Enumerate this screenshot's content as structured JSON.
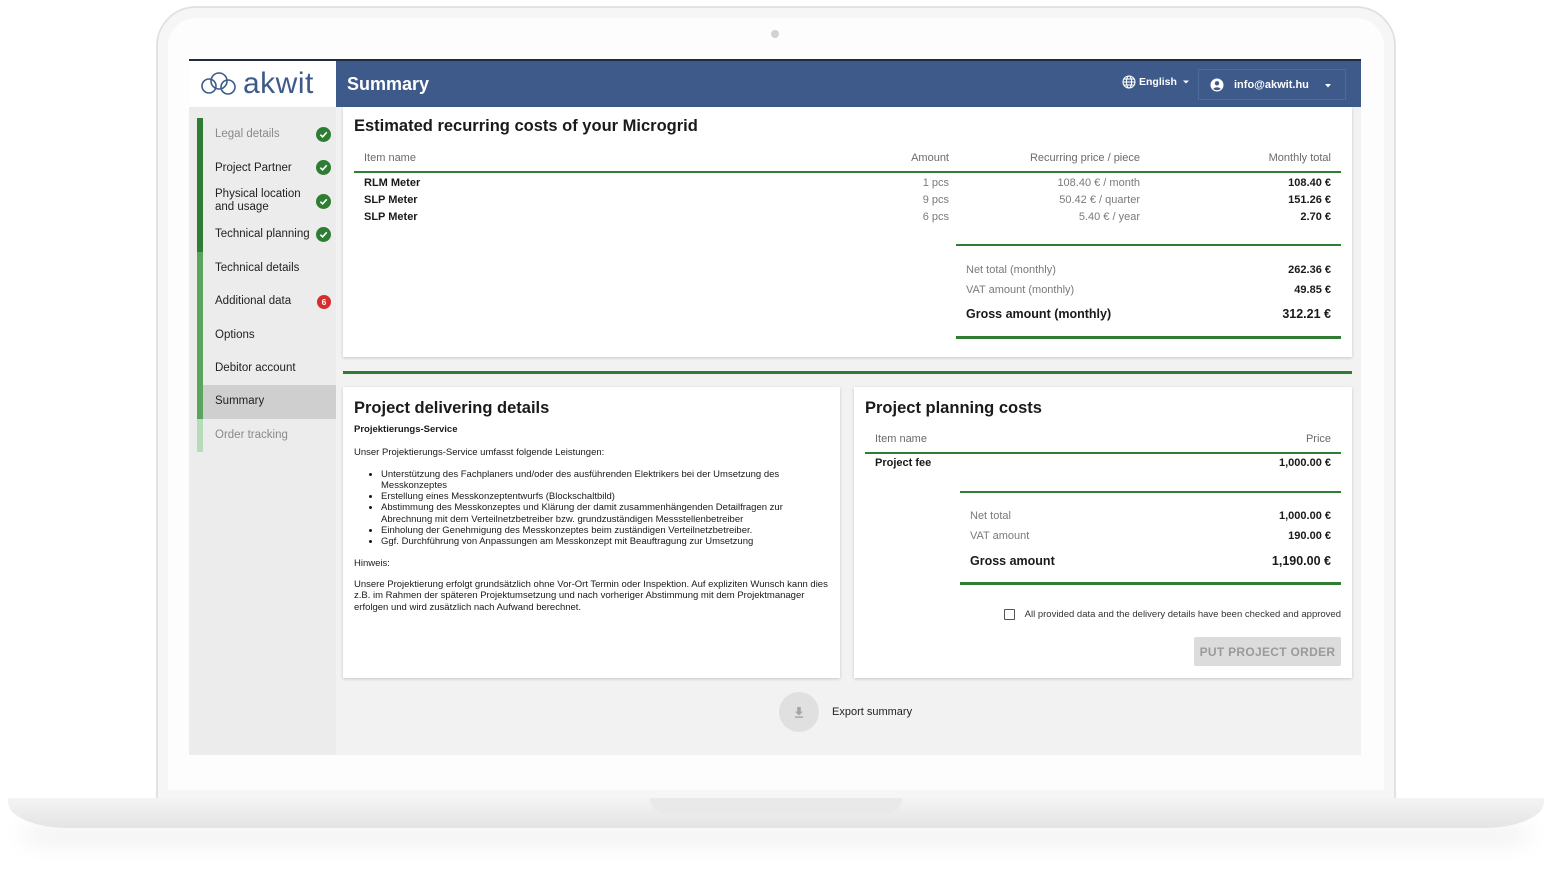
{
  "brand": {
    "name": "akwit",
    "color": "#3d5a8a"
  },
  "colors": {
    "header": "#3d5a8a",
    "accent_green": "#2e7d32",
    "error_red": "#d32f2f"
  },
  "header": {
    "title": "Summary",
    "language": "English",
    "user_email": "info@akwit.hu"
  },
  "sidebar": {
    "items": [
      {
        "label": "Legal details",
        "status": "done"
      },
      {
        "label": "Project Partner",
        "status": "done"
      },
      {
        "label": "Physical location and usage",
        "status": "done"
      },
      {
        "label": "Technical planning",
        "status": "done"
      },
      {
        "label": "Technical details",
        "status": "none"
      },
      {
        "label": "Additional data",
        "status": "error",
        "badge": "6"
      },
      {
        "label": "Options",
        "status": "none"
      },
      {
        "label": "Debitor account",
        "status": "none"
      },
      {
        "label": "Summary",
        "status": "active"
      },
      {
        "label": "Order tracking",
        "status": "disabled"
      }
    ]
  },
  "recurring": {
    "title": "Estimated recurring costs of your Microgrid",
    "columns": {
      "item": "Item name",
      "amount": "Amount",
      "price": "Recurring price / piece",
      "total": "Monthly total"
    },
    "rows": [
      {
        "item": "RLM Meter",
        "amount": "1 pcs",
        "price": "108.40 € / month",
        "total": "108.40 €"
      },
      {
        "item": "SLP Meter",
        "amount": "9 pcs",
        "price": "50.42 € / quarter",
        "total": "151.26 €"
      },
      {
        "item": "SLP Meter",
        "amount": "6 pcs",
        "price": "5.40 € / year",
        "total": "2.70 €"
      }
    ],
    "net_label": "Net total (monthly)",
    "net_value": "262.36 €",
    "vat_label": "VAT amount (monthly)",
    "vat_value": "49.85 €",
    "gross_label": "Gross amount (monthly)",
    "gross_value": "312.21 €"
  },
  "delivering": {
    "title": "Project delivering details",
    "service_name": "Projektierungs-Service",
    "intro": "Unser Projektierungs-Service umfasst folgende Leistungen:",
    "bullets": [
      "Unterstützung des Fachplaners und/oder des ausführenden Elektrikers bei der Umsetzung des Messkonzeptes",
      "Erstellung eines Messkonzeptentwurfs (Blockschaltbild)",
      "Abstimmung des Messkonzeptes und Klärung der damit zusammenhängenden Detailfragen zur Abrechnung mit dem Verteilnetzbetreiber bzw. grundzuständigen Messstellenbetreiber",
      "Einholung der Genehmigung des Messkonzeptes beim zuständigen Verteilnetzbetreiber.",
      "Ggf. Durchführung von Anpassungen am Messkonzept mit Beauftragung zur Umsetzung"
    ],
    "note_label": "Hinweis:",
    "note": "Unsere Projektierung erfolgt grundsätzlich ohne Vor-Ort Termin oder Inspektion. Auf expliziten Wunsch kann dies z.B. im Rahmen der späteren Projektumsetzung und nach vorheriger Abstimmung mit dem Projektmanager erfolgen und wird zusätzlich nach Aufwand berechnet."
  },
  "planning": {
    "title": "Project planning costs",
    "columns": {
      "item": "Item name",
      "price": "Price"
    },
    "rows": [
      {
        "item": "Project fee",
        "price": "1,000.00 €"
      }
    ],
    "net_label": "Net total",
    "net_value": "1,000.00 €",
    "vat_label": "VAT amount",
    "vat_value": "190.00 €",
    "gross_label": "Gross amount",
    "gross_value": "1,190.00 €",
    "confirm_label": "All provided data and the delivery details have been checked and approved",
    "confirm_checked": false,
    "order_button": "PUT PROJECT ORDER"
  },
  "export": {
    "label": "Export summary",
    "icon": "download-icon"
  }
}
